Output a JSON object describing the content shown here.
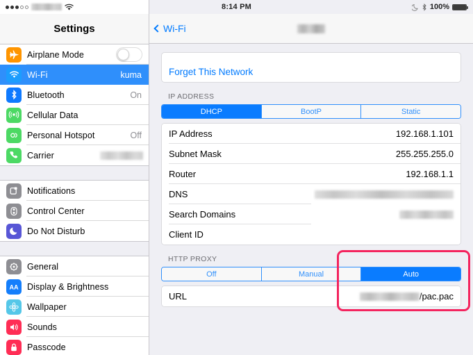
{
  "status_bar": {
    "signal_dots_filled": 3,
    "signal_dots_empty": 2,
    "carrier_redacted": true,
    "wifi_icon": "wifi-icon",
    "time": "8:14 PM",
    "moon_icon": "moon-icon",
    "bluetooth_icon": "bluetooth-icon",
    "battery_percent": "100%",
    "battery_icon": "battery-full-icon"
  },
  "sidebar": {
    "title": "Settings",
    "groups": [
      {
        "items": [
          {
            "label": "Airplane Mode",
            "icon": "airplane-icon",
            "icon_color": "#FF9500",
            "accessory": "toggle",
            "toggle_on": false,
            "value": ""
          },
          {
            "label": "Wi-Fi",
            "icon": "wifi-icon",
            "icon_color": "#1C9DFE",
            "accessory": "value",
            "value": "kuma",
            "selected": true
          },
          {
            "label": "Bluetooth",
            "icon": "bluetooth-icon",
            "icon_color": "#0F7AFF",
            "accessory": "value",
            "value": "On"
          },
          {
            "label": "Cellular Data",
            "icon": "cellular-antenna-icon",
            "icon_color": "#4CD964",
            "accessory": "none",
            "value": ""
          },
          {
            "label": "Personal Hotspot",
            "icon": "hotspot-link-icon",
            "icon_color": "#4CD964",
            "accessory": "value",
            "value": "Off"
          },
          {
            "label": "Carrier",
            "icon": "phone-icon",
            "icon_color": "#4CD964",
            "accessory": "blurred",
            "value": ""
          }
        ]
      },
      {
        "items": [
          {
            "label": "Notifications",
            "icon": "notifications-icon",
            "icon_color": "#8E8E93",
            "accessory": "none",
            "value": ""
          },
          {
            "label": "Control Center",
            "icon": "control-center-icon",
            "icon_color": "#8E8E93",
            "accessory": "none",
            "value": ""
          },
          {
            "label": "Do Not Disturb",
            "icon": "moon-icon",
            "icon_color": "#5856D6",
            "accessory": "none",
            "value": ""
          }
        ]
      },
      {
        "items": [
          {
            "label": "General",
            "icon": "gear-icon",
            "icon_color": "#8E8E93",
            "accessory": "none",
            "value": ""
          },
          {
            "label": "Display & Brightness",
            "icon": "text-size-aa-icon",
            "icon_color": "#147EFB",
            "accessory": "none",
            "value": ""
          },
          {
            "label": "Wallpaper",
            "icon": "flower-wallpaper-icon",
            "icon_color": "#55C7E8",
            "accessory": "none",
            "value": ""
          },
          {
            "label": "Sounds",
            "icon": "speaker-icon",
            "icon_color": "#FF2D55",
            "accessory": "none",
            "value": ""
          },
          {
            "label": "Passcode",
            "icon": "lock-icon",
            "icon_color": "#FF2D55",
            "accessory": "none",
            "value": ""
          }
        ]
      }
    ]
  },
  "navbar": {
    "back_label": "Wi-Fi",
    "back_icon": "chevron-left-icon",
    "title_redacted": true
  },
  "main": {
    "forget_network_label": "Forget This Network",
    "ip_address_section": {
      "header": "IP ADDRESS",
      "segments": [
        "DHCP",
        "BootP",
        "Static"
      ],
      "selected_segment": "DHCP",
      "rows": [
        {
          "label": "IP Address",
          "value": "192.168.1.101",
          "redacted": false
        },
        {
          "label": "Subnet Mask",
          "value": "255.255.255.0",
          "redacted": false
        },
        {
          "label": "Router",
          "value": "192.168.1.1",
          "redacted": false
        },
        {
          "label": "DNS",
          "value": "",
          "redacted": true
        },
        {
          "label": "Search Domains",
          "value": "",
          "redacted": true
        },
        {
          "label": "Client ID",
          "value": "",
          "redacted": false
        }
      ]
    },
    "http_proxy_section": {
      "header": "HTTP PROXY",
      "segments": [
        "Off",
        "Manual",
        "Auto"
      ],
      "selected_segment": "Auto",
      "rows": [
        {
          "label": "URL",
          "value_suffix": "/pac.pac",
          "value_redacted": true
        }
      ]
    }
  },
  "annotation": {
    "shape": "rounded-rectangle-highlight",
    "color": "#F4245E"
  },
  "colors": {
    "accent_blue": "#007AFF",
    "segment_blue": "#0A7CFF",
    "selected_row_blue": "#2F8FFB",
    "background": "#EFEFF4",
    "annotation_pink": "#F4245E"
  }
}
